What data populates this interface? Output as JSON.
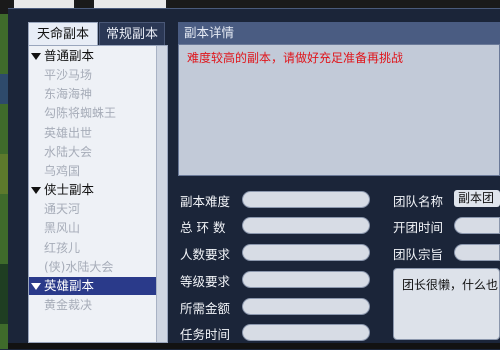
{
  "tabs": [
    "天命副本",
    "常规副本"
  ],
  "tree": {
    "categories": [
      {
        "label": "普通副本",
        "selected": false,
        "items": [
          "平沙马场",
          "东海海神",
          "勾陈将蜘蛛王",
          "英雄出世",
          "水陆大会",
          "乌鸡国"
        ]
      },
      {
        "label": "侠士副本",
        "selected": false,
        "items": [
          "通天河",
          "黑风山",
          "红孩儿",
          "(侠)水陆大会"
        ]
      },
      {
        "label": "英雄副本",
        "selected": true,
        "items": [
          "黄金裁决"
        ]
      }
    ]
  },
  "detail": {
    "header": "副本详情",
    "text": "难度较高的副本，请做好充足准备再挑战"
  },
  "form": {
    "difficulty_label": "副本难度",
    "rounds_label": "总 环 数",
    "people_label": "人数要求",
    "level_label": "等级要求",
    "money_label": "所需金额",
    "time_label": "任务时间"
  },
  "team": {
    "name_label": "团队名称",
    "name_value": "副本团",
    "open_time_label": "开团时间",
    "motto_label": "团队宗旨",
    "motto_text": "团长很懒，什么也"
  },
  "colors": {
    "accent_red": "#e0151b",
    "selected": "#2a3a8a",
    "header": "#4a5c82"
  }
}
